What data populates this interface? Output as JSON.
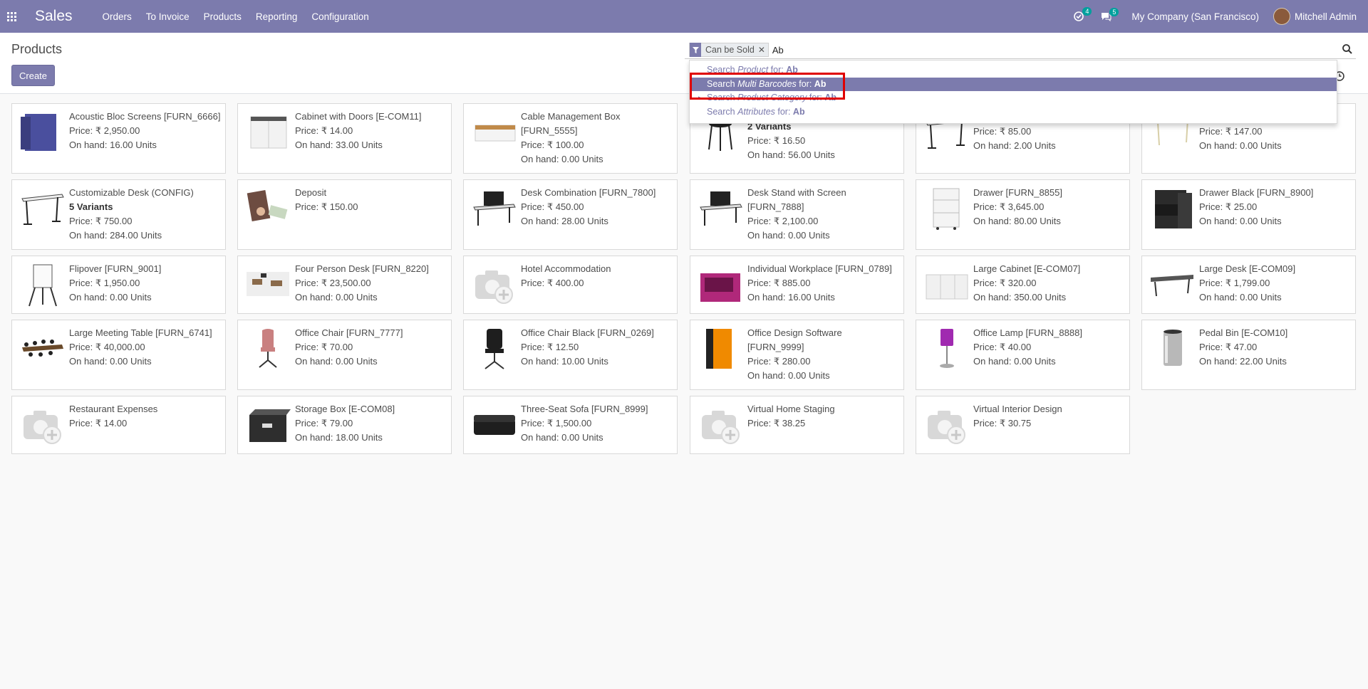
{
  "navbar": {
    "brand": "Sales",
    "menu": [
      "Orders",
      "To Invoice",
      "Products",
      "Reporting",
      "Configuration"
    ],
    "activity_count": "4",
    "messages_count": "5",
    "company": "My Company (San Francisco)",
    "user": "Mitchell Admin",
    "accent_color": "#7c7bad"
  },
  "control_panel": {
    "breadcrumb": "Products",
    "create_label": "Create",
    "facet_label": "Can be Sold",
    "search_value": "Ab"
  },
  "autocomplete": {
    "items": [
      {
        "prefix": "Search ",
        "field": "Product",
        "mid": " for: ",
        "value": "Ab"
      },
      {
        "prefix": "Search ",
        "field": "Multi Barcodes",
        "mid": " for: ",
        "value": "Ab"
      },
      {
        "prefix": "Search ",
        "field": "Product Category",
        "mid": " for: ",
        "value": "Ab"
      },
      {
        "prefix": "Search ",
        "field": "Attributes",
        "mid": " for: ",
        "value": "Ab"
      }
    ],
    "active_index": 1
  },
  "products": [
    {
      "name": "Acoustic Bloc Screens [FURN_6666]",
      "price": "Price: ₹ 2,950.00",
      "onhand": "On hand: 16.00 Units",
      "img": "screen"
    },
    {
      "name": "Cabinet with Doors [E-COM11]",
      "price": "Price: ₹ 14.00",
      "onhand": "On hand: 33.00 Units",
      "img": "cabinet"
    },
    {
      "name": "Cable Management Box [FURN_5555]",
      "price": "Price: ₹ 100.00",
      "onhand": "On hand: 0.00 Units",
      "img": "box-wood"
    },
    {
      "name": "",
      "variants": "2 Variants",
      "price": "Price: ₹ 16.50",
      "onhand": "On hand: 56.00 Units",
      "img": "stool"
    },
    {
      "name": "",
      "price": "Price: ₹ 85.00",
      "onhand": "On hand: 2.00 Units",
      "img": "desk"
    },
    {
      "name": "",
      "price": "Price: ₹ 147.00",
      "onhand": "On hand: 0.00 Units",
      "img": "desk-light"
    },
    {
      "name": "Customizable Desk (CONFIG)",
      "variants": "5 Variants",
      "price": "Price: ₹ 750.00",
      "onhand": "On hand: 284.00 Units",
      "img": "desk"
    },
    {
      "name": "Deposit",
      "price": "Price: ₹ 150.00",
      "onhand": "",
      "img": "money"
    },
    {
      "name": "Desk Combination [FURN_7800]",
      "price": "Price: ₹ 450.00",
      "onhand": "On hand: 28.00 Units",
      "img": "desk-combo"
    },
    {
      "name": "Desk Stand with Screen [FURN_7888]",
      "price": "Price: ₹ 2,100.00",
      "onhand": "On hand: 0.00 Units",
      "img": "desk-combo"
    },
    {
      "name": "Drawer [FURN_8855]",
      "price": "Price: ₹ 3,645.00",
      "onhand": "On hand: 80.00 Units",
      "img": "drawer-white"
    },
    {
      "name": "Drawer Black [FURN_8900]",
      "price": "Price: ₹ 25.00",
      "onhand": "On hand: 0.00 Units",
      "img": "drawer-black"
    },
    {
      "name": "Flipover [FURN_9001]",
      "price": "Price: ₹ 1,950.00",
      "onhand": "On hand: 0.00 Units",
      "img": "flipover"
    },
    {
      "name": "Four Person Desk [FURN_8220]",
      "price": "Price: ₹ 23,500.00",
      "onhand": "On hand: 0.00 Units",
      "img": "office"
    },
    {
      "name": "Hotel Accommodation",
      "price": "Price: ₹ 400.00",
      "onhand": "",
      "img": "placeholder"
    },
    {
      "name": "Individual Workplace [FURN_0789]",
      "price": "Price: ₹ 885.00",
      "onhand": "On hand: 16.00 Units",
      "img": "workplace"
    },
    {
      "name": "Large Cabinet [E-COM07]",
      "price": "Price: ₹ 320.00",
      "onhand": "On hand: 350.00 Units",
      "img": "large-cabinet"
    },
    {
      "name": "Large Desk [E-COM09]",
      "price": "Price: ₹ 1,799.00",
      "onhand": "On hand: 0.00 Units",
      "img": "large-desk"
    },
    {
      "name": "Large Meeting Table [FURN_6741]",
      "price": "Price: ₹ 40,000.00",
      "onhand": "On hand: 0.00 Units",
      "img": "meeting"
    },
    {
      "name": "Office Chair [FURN_7777]",
      "price": "Price: ₹ 70.00",
      "onhand": "On hand: 0.00 Units",
      "img": "chair-pink"
    },
    {
      "name": "Office Chair Black [FURN_0269]",
      "price": "Price: ₹ 12.50",
      "onhand": "On hand: 10.00 Units",
      "img": "chair-black"
    },
    {
      "name": "Office Design Software [FURN_9999]",
      "price": "Price: ₹ 280.00",
      "onhand": "On hand: 0.00 Units",
      "img": "software"
    },
    {
      "name": "Office Lamp [FURN_8888]",
      "price": "Price: ₹ 40.00",
      "onhand": "On hand: 0.00 Units",
      "img": "lamp"
    },
    {
      "name": "Pedal Bin [E-COM10]",
      "price": "Price: ₹ 47.00",
      "onhand": "On hand: 22.00 Units",
      "img": "bin"
    },
    {
      "name": "Restaurant Expenses",
      "price": "Price: ₹ 14.00",
      "onhand": "",
      "img": "placeholder"
    },
    {
      "name": "Storage Box [E-COM08]",
      "price": "Price: ₹ 79.00",
      "onhand": "On hand: 18.00 Units",
      "img": "storage"
    },
    {
      "name": "Three-Seat Sofa [FURN_8999]",
      "price": "Price: ₹ 1,500.00",
      "onhand": "On hand: 0.00 Units",
      "img": "sofa"
    },
    {
      "name": "Virtual Home Staging",
      "price": "Price: ₹ 38.25",
      "onhand": "",
      "img": "placeholder"
    },
    {
      "name": "Virtual Interior Design",
      "price": "Price: ₹ 30.75",
      "onhand": "",
      "img": "placeholder"
    }
  ]
}
